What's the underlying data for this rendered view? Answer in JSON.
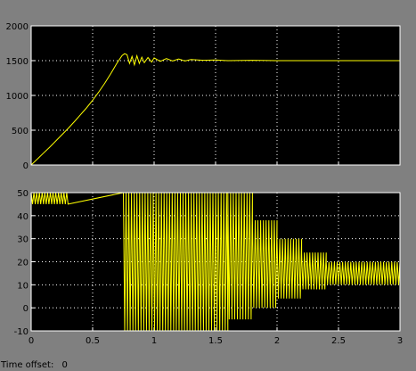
{
  "status": {
    "time_offset_label": "Time offset:",
    "time_offset_value": "0"
  },
  "colors": {
    "window_background": "#808080",
    "plot_background": "#000000",
    "grid": "#ffffff",
    "trace": "#ffff00"
  },
  "chart_data": [
    {
      "type": "line",
      "title": "",
      "xlabel": "",
      "ylabel": "",
      "xlim": [
        0,
        3
      ],
      "ylim": [
        0,
        2000
      ],
      "x_ticks": [
        0,
        0.5,
        1,
        1.5,
        2,
        2.5,
        3
      ],
      "y_ticks": [
        0,
        500,
        1000,
        1500,
        2000
      ],
      "grid": true,
      "series": [
        {
          "x": [
            0,
            0.05,
            0.1,
            0.15,
            0.2,
            0.25,
            0.3,
            0.35,
            0.4,
            0.45,
            0.5,
            0.55,
            0.6,
            0.65,
            0.7,
            0.74,
            0.76,
            0.78,
            0.8,
            0.82,
            0.84,
            0.86,
            0.88,
            0.9,
            0.92,
            0.95,
            0.98,
            1.0,
            1.05,
            1.1,
            1.15,
            1.2,
            1.25,
            1.3,
            1.4,
            1.5,
            1.6,
            1.8,
            2.0,
            2.5,
            3.0
          ],
          "y": [
            0,
            85,
            170,
            255,
            345,
            435,
            525,
            620,
            720,
            820,
            930,
            1050,
            1180,
            1320,
            1470,
            1575,
            1600,
            1585,
            1460,
            1560,
            1440,
            1570,
            1460,
            1550,
            1470,
            1545,
            1480,
            1540,
            1490,
            1530,
            1495,
            1525,
            1495,
            1515,
            1505,
            1510,
            1500,
            1505,
            1500,
            1500,
            1500
          ]
        }
      ]
    },
    {
      "type": "line",
      "title": "",
      "xlabel": "",
      "ylabel": "",
      "xlim": [
        0,
        3
      ],
      "ylim": [
        -10,
        50
      ],
      "x_ticks": [
        0,
        0.5,
        1,
        1.5,
        2,
        2.5,
        3
      ],
      "x_tick_labels": [
        "0",
        "0.5",
        "1",
        "1.5",
        "2",
        "2.5",
        "3"
      ],
      "y_ticks": [
        -10,
        0,
        10,
        20,
        30,
        40,
        50
      ],
      "grid": true,
      "series": [
        {
          "description_of_segments": "oscillating trace clipped at display limits",
          "segments": [
            {
              "x_range": [
                0,
                0.3
              ],
              "y_min": 45,
              "y_max": 50
            },
            {
              "x_range": [
                0.75,
                1.6
              ],
              "y_min": -10,
              "y_max": 50
            },
            {
              "x_range": [
                1.6,
                1.8
              ],
              "y_min": -5,
              "y_max": 50
            },
            {
              "x_range": [
                1.8,
                2.0
              ],
              "y_min": 0,
              "y_max": 38
            },
            {
              "x_range": [
                2.0,
                2.2
              ],
              "y_min": 4,
              "y_max": 30
            },
            {
              "x_range": [
                2.2,
                2.4
              ],
              "y_min": 8,
              "y_max": 24
            },
            {
              "x_range": [
                2.4,
                3.0
              ],
              "y_min": 10,
              "y_max": 20
            }
          ]
        }
      ]
    }
  ]
}
